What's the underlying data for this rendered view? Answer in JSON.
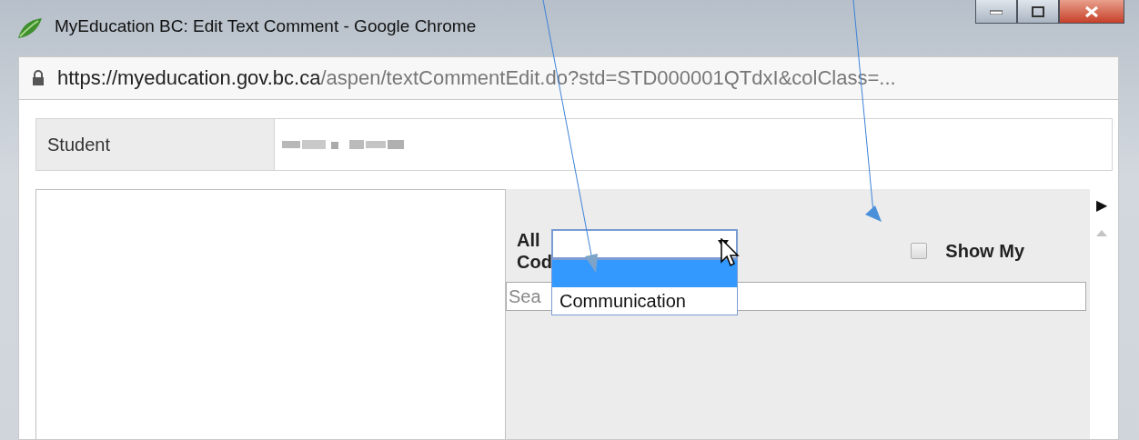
{
  "window": {
    "title": "MyEducation BC: Edit Text Comment - Google Chrome"
  },
  "address_bar": {
    "host": "https://myeducation.gov.bc.ca",
    "path": "/aspen/textCommentEdit.do?std=STD000001QTdxI&colClass=..."
  },
  "student": {
    "label": "Student"
  },
  "filter": {
    "label_top": "All",
    "label_bottom": "Cod",
    "search_placeholder": "Sea",
    "show_my": {
      "label": "Show My",
      "checked": false
    }
  },
  "dropdown": {
    "options": [
      {
        "selected": true
      },
      {
        "label": "Communication",
        "selected": false
      }
    ]
  },
  "side_arrow": "▶"
}
